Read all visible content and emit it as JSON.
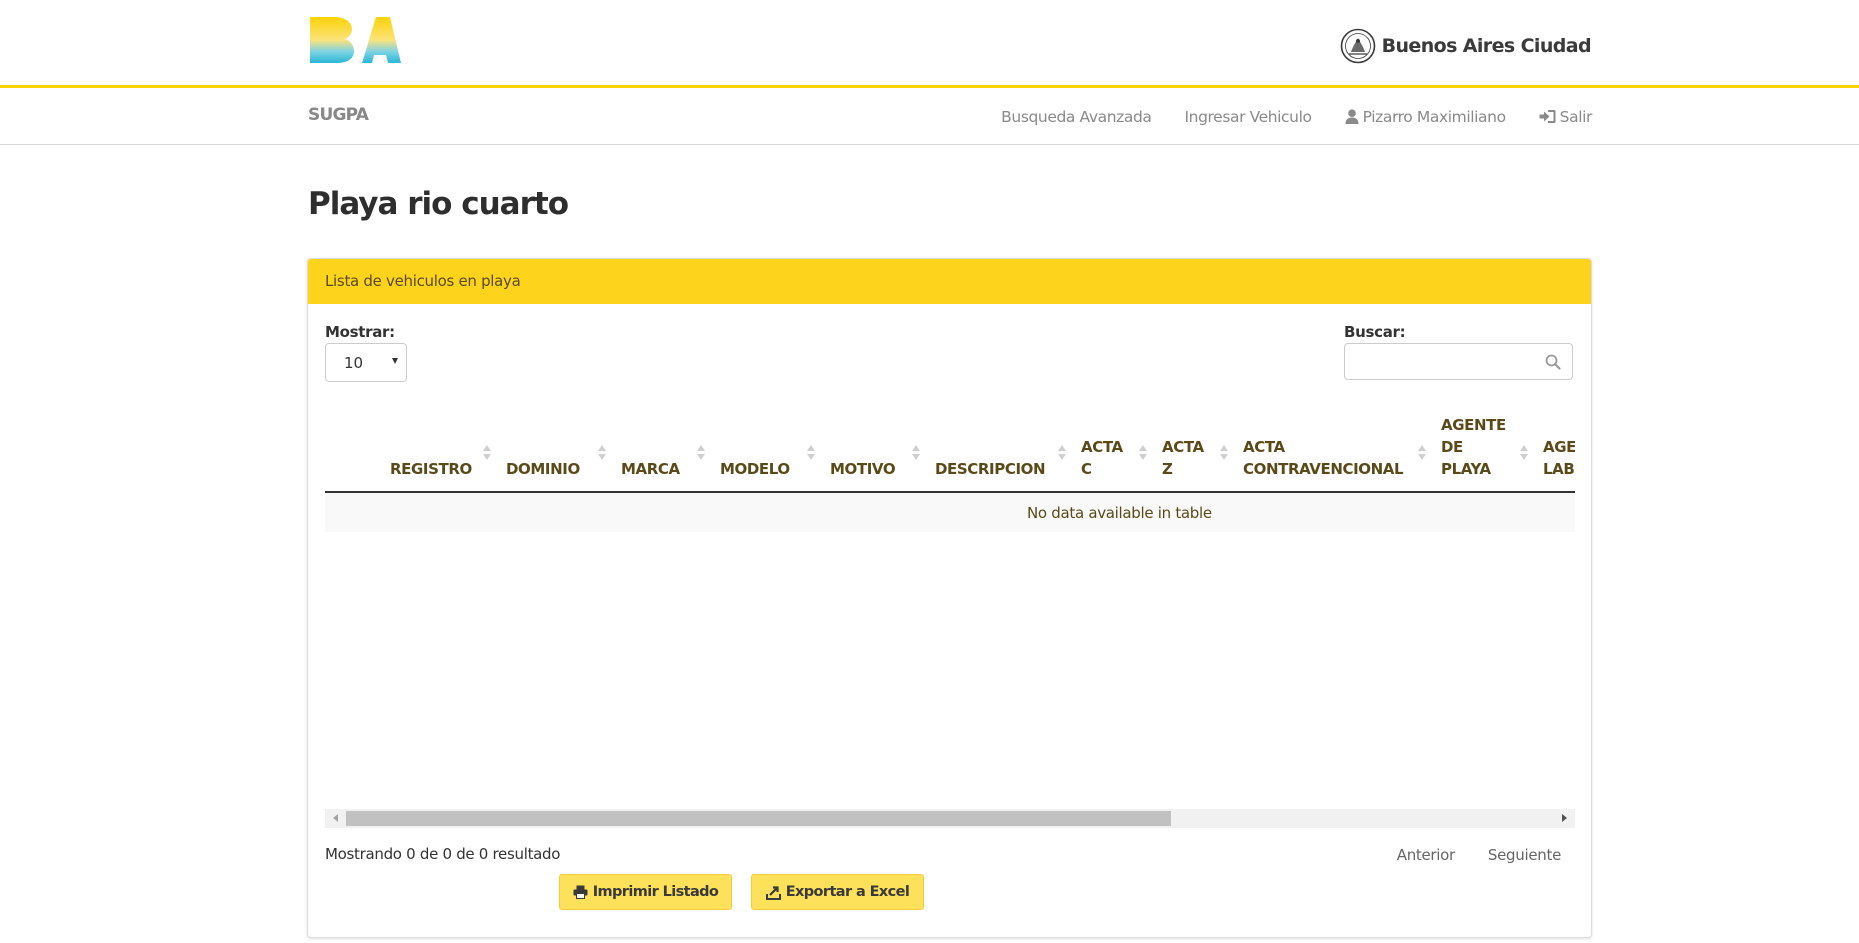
{
  "header": {
    "logo_text": "BA",
    "city_name": "Buenos Aires Ciudad"
  },
  "navbar": {
    "brand": "SUGPA",
    "links": [
      {
        "label": "Busqueda Avanzada",
        "icon": ""
      },
      {
        "label": "Ingresar Vehiculo",
        "icon": ""
      },
      {
        "label": "Pizarro Maximiliano",
        "icon": "user-icon"
      },
      {
        "label": "Salir",
        "icon": "log-in-icon"
      }
    ]
  },
  "page": {
    "title": "Playa rio cuarto"
  },
  "panel": {
    "heading": "Lista de vehiculos en playa",
    "show_label": "Mostrar:",
    "show_value": "10",
    "search_label": "Buscar:",
    "search_value": "",
    "search_icon": "search-icon"
  },
  "table": {
    "columns": [
      "",
      "REGISTRO",
      "DOMINIO",
      "MARCA",
      "MODELO",
      "MOTIVO",
      "DESCRIPCION",
      "ACTA C",
      "ACTA Z",
      "ACTA CONTRAVENCIONAL",
      "AGENTE DE PLAYA",
      "AGENTE LAB"
    ],
    "rows": [],
    "empty_message": "No data available in table"
  },
  "footer": {
    "info": "Mostrando 0 de 0 de 0 resultado",
    "prev": "Anterior",
    "next": "Seguiente",
    "print_button": "Imprimir Listado",
    "excel_button": "Exportar a Excel"
  },
  "colors": {
    "accent_yellow": "#fdd31b",
    "button_yellow": "#fde15a",
    "header_text": "#5a4a1a"
  }
}
